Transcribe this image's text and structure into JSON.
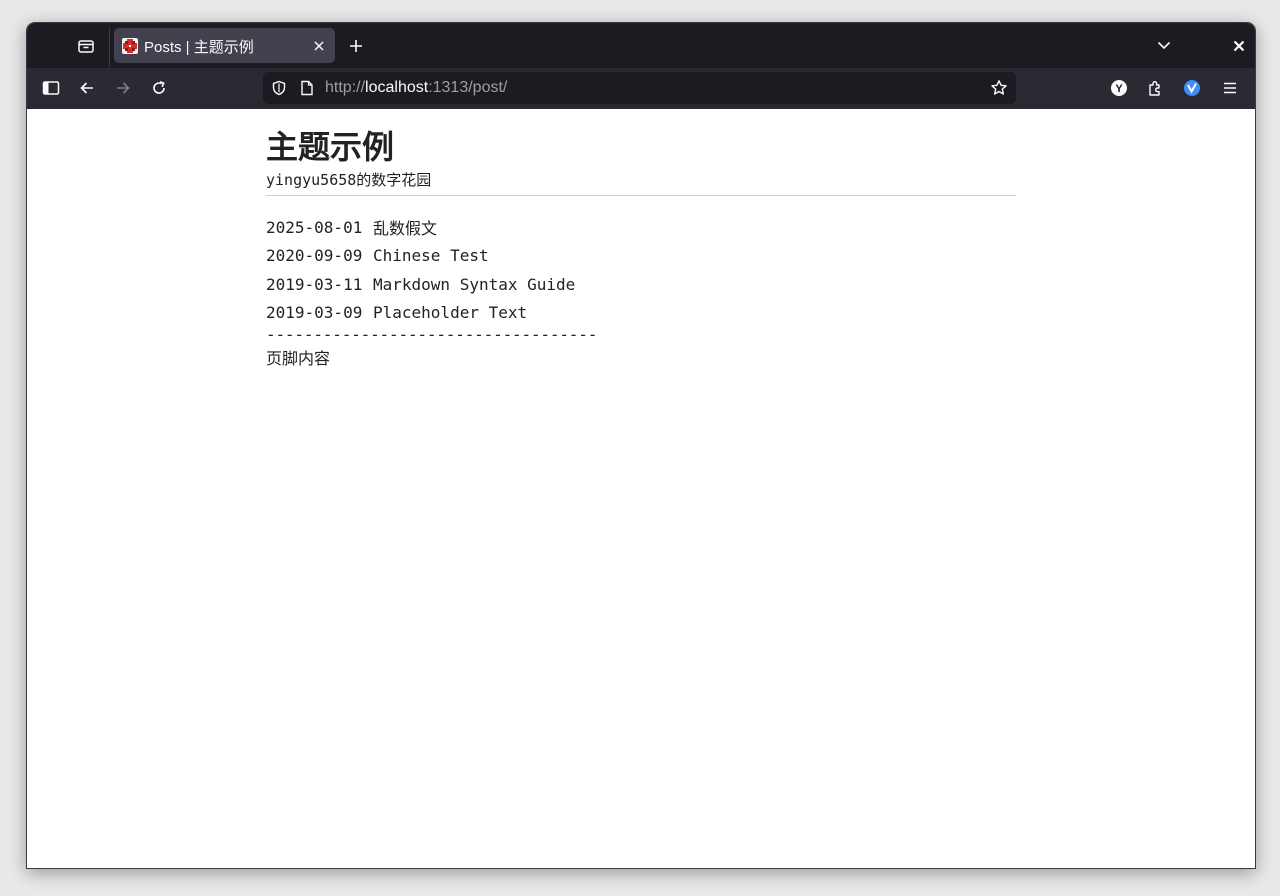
{
  "browser": {
    "tab": {
      "title": "Posts | 主题示例",
      "favicon": "site-favicon"
    },
    "address": {
      "scheme": "http://",
      "host": "localhost",
      "rest": ":1313/post/"
    },
    "icons": [
      "firefox-view-icon",
      "new-tab-icon",
      "list-all-tabs-icon",
      "close-window-icon",
      "sidebar-icon",
      "back-icon",
      "forward-icon",
      "reload-icon",
      "shield-icon",
      "page-icon",
      "bookmark-star-icon",
      "y-extension-icon",
      "extensions-icon",
      "v-extension-icon",
      "menu-icon"
    ],
    "colors": {
      "tabbar": "#1c1b22",
      "navbar": "#2b2a33",
      "active_tab": "#42414d",
      "accent_blue": "#3e8ef7"
    }
  },
  "page": {
    "title": "主题示例",
    "subtitle": "yingyu5658的数字花园",
    "posts": [
      {
        "date": "2025-08-01",
        "title": "乱数假文"
      },
      {
        "date": "2020-09-09",
        "title": "Chinese Test"
      },
      {
        "date": "2019-03-11",
        "title": "Markdown Syntax Guide"
      },
      {
        "date": "2019-03-09",
        "title": "Placeholder Text"
      }
    ],
    "divider": "-----------------------------------",
    "footer": "页脚内容"
  }
}
